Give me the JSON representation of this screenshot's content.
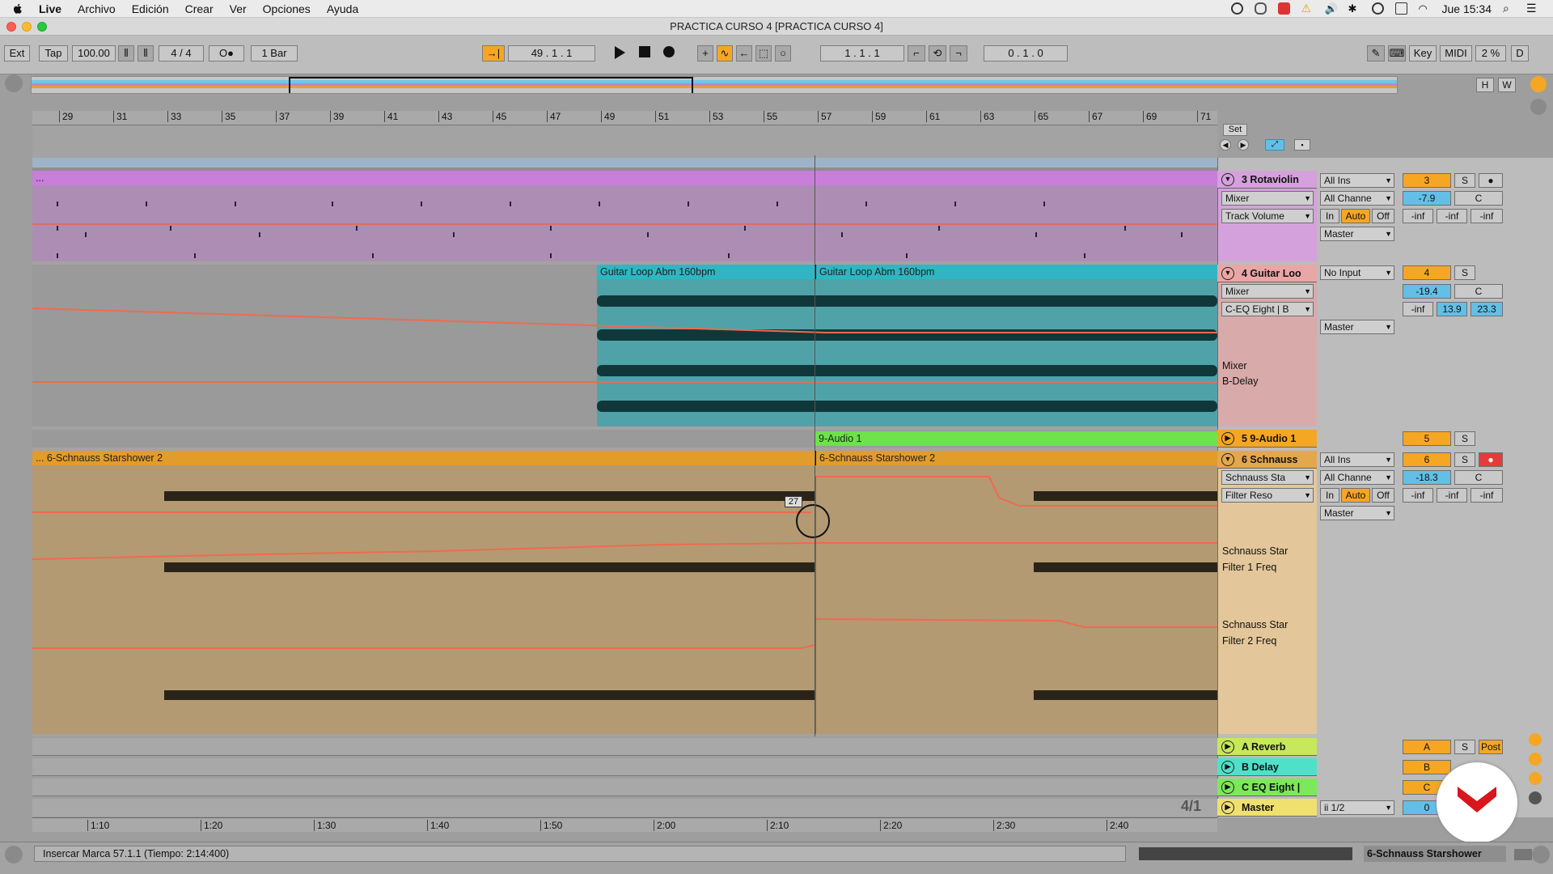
{
  "menubar": {
    "app": "Live",
    "items": [
      "Archivo",
      "Edición",
      "Crear",
      "Ver",
      "Opciones",
      "Ayuda"
    ],
    "clock": "Jue 15:34"
  },
  "window": {
    "title": "PRACTICA CURSO 4  [PRACTICA CURSO 4]"
  },
  "toolbar": {
    "ext": "Ext",
    "tap": "Tap",
    "tempo": "100.00",
    "signature": "4 / 4",
    "metro": "O●",
    "quant": "1 Bar",
    "position": "49 .  1 .  1",
    "loop_start": "1 .  1 .  1",
    "loop_length": "0 .  1 .  0",
    "key": "Key",
    "midi": "MIDI",
    "cpu": "2 %",
    "d": "D"
  },
  "overview": {
    "h": "H",
    "w": "W"
  },
  "ruler": {
    "bars": [
      "29",
      "31",
      "33",
      "35",
      "37",
      "39",
      "41",
      "43",
      "45",
      "47",
      "49",
      "51",
      "53",
      "55",
      "57",
      "59",
      "61",
      "63",
      "65",
      "67",
      "69",
      "71"
    ]
  },
  "locators": {
    "set": "Set"
  },
  "tracks": {
    "rotaviolin": {
      "name": "3 Rotaviolin",
      "clip_label": "...",
      "device": "Mixer",
      "param": "Track Volume",
      "input": "All Ins",
      "channel": "All Channe",
      "output": "Master",
      "in": "In",
      "auto": "Auto",
      "off": "Off",
      "number": "3",
      "solo": "S",
      "volume": "-7.9",
      "pan": "C",
      "meters": [
        "-inf",
        "-inf",
        "-inf"
      ]
    },
    "guitar": {
      "name": "4 Guitar Loo",
      "clips": [
        "Guitar Loop Abm 160bpm",
        "Guitar Loop Abm 160bpm"
      ],
      "device": "Mixer",
      "param": "C-EQ Eight | B",
      "input": "No Input",
      "output": "Master",
      "number": "4",
      "solo": "S",
      "volume": "-19.4",
      "pan": "C",
      "meters": [
        "-inf",
        "13.9",
        "23.3"
      ],
      "lane_device": "Mixer",
      "lane_param": "B-Delay"
    },
    "audio1": {
      "name": "5 9-Audio 1",
      "clip": "9-Audio 1",
      "number": "5",
      "solo": "S"
    },
    "schnauss": {
      "name": "6 Schnauss",
      "clip_left": "... 6-Schnauss Starshower 2",
      "clip_right": "6-Schnauss Starshower 2",
      "device": "Schnauss Sta",
      "param": "Filter Reso",
      "input": "All Ins",
      "channel": "All Channe",
      "output": "Master",
      "in": "In",
      "auto": "Auto",
      "off": "Off",
      "number": "6",
      "solo": "S",
      "volume": "-18.3",
      "pan": "C",
      "meters": [
        "-inf",
        "-inf",
        "-inf"
      ],
      "lane1_device": "Schnauss Star",
      "lane1_param": "Filter 1 Freq",
      "lane2_device": "Schnauss Star",
      "lane2_param": "Filter 2 Freq",
      "tooltip": "27"
    }
  },
  "returns": [
    {
      "name": "A Reverb",
      "letter": "A",
      "solo": "S",
      "post": "Post",
      "color": "#c6e85a"
    },
    {
      "name": "B Delay",
      "letter": "B",
      "color": "#4fe0c9"
    },
    {
      "name": "C EQ Eight |",
      "letter": "C",
      "color": "#7de85a"
    },
    {
      "name": "Master",
      "output": "ii 1/2",
      "number": "0",
      "color": "#f0e070"
    }
  ],
  "bottom": {
    "times": [
      "1:10",
      "1:20",
      "1:30",
      "1:40",
      "1:50",
      "2:00",
      "2:10",
      "2:20",
      "2:30",
      "2:40"
    ],
    "zoom": "4/1",
    "status": "Insercar Marca 57.1.1 (Tiempo: 2:14:400)",
    "track_name": "6-Schnauss Starshower"
  }
}
